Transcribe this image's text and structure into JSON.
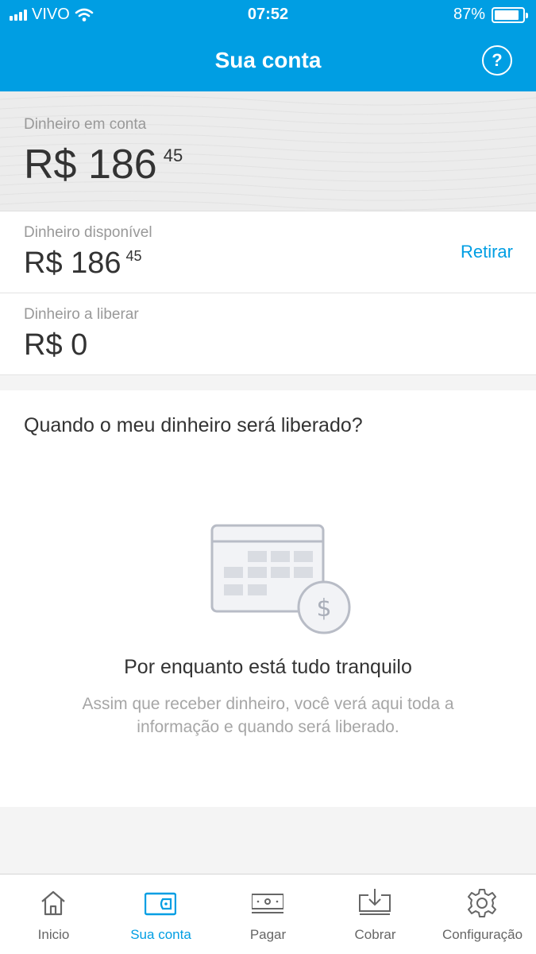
{
  "status_bar": {
    "carrier": "VIVO",
    "time": "07:52",
    "battery": "87%",
    "battery_level": 0.87
  },
  "header": {
    "title": "Sua conta",
    "help_label": "?"
  },
  "balance": {
    "label": "Dinheiro em conta",
    "currency": "R$",
    "whole": "186",
    "cents": "45"
  },
  "available": {
    "label": "Dinheiro disponível",
    "currency": "R$",
    "whole": "186",
    "cents": "45",
    "action": "Retirar"
  },
  "pending": {
    "label": "Dinheiro a liberar",
    "amount": "R$ 0"
  },
  "release_info": {
    "question": "Quando o meu dinheiro será liberado?",
    "empty_title": "Por enquanto está tudo tranquilo",
    "empty_description": "Assim que receber dinheiro, você verá aqui toda a informação e quando será liberado."
  },
  "tabs": [
    {
      "label": "Inicio",
      "icon": "home-icon",
      "active": false
    },
    {
      "label": "Sua conta",
      "icon": "wallet-icon",
      "active": true
    },
    {
      "label": "Pagar",
      "icon": "cash-icon",
      "active": false
    },
    {
      "label": "Cobrar",
      "icon": "receive-icon",
      "active": false
    },
    {
      "label": "Configuração",
      "icon": "gear-icon",
      "active": false
    }
  ],
  "colors": {
    "brand": "#009ee3",
    "text": "#333333",
    "muted": "#999999"
  }
}
